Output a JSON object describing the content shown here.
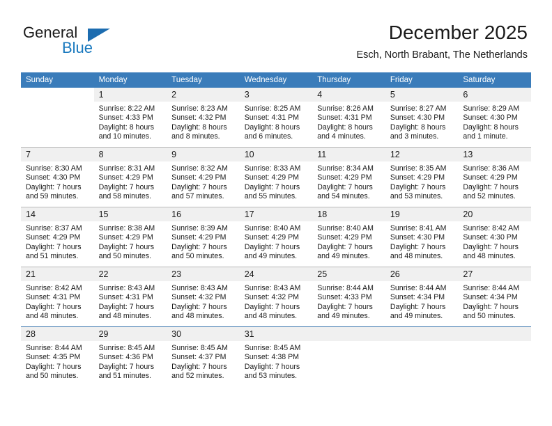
{
  "brand": {
    "word_one": "General",
    "word_two": "Blue",
    "logo_icon": "triangle-icon"
  },
  "header": {
    "title": "December 2025",
    "subtitle": "Esch, North Brabant, The Netherlands"
  },
  "colors": {
    "header_blue": "#3a7cba",
    "brand_blue": "#1878be",
    "band_gray": "#f0f0f0",
    "row_rule": "#b8b8b8",
    "last_row_rule": "#2f6ea8"
  },
  "weekday_headers": [
    "Sunday",
    "Monday",
    "Tuesday",
    "Wednesday",
    "Thursday",
    "Friday",
    "Saturday"
  ],
  "weeks": [
    [
      {
        "day": "",
        "lines": []
      },
      {
        "day": "1",
        "lines": [
          "Sunrise: 8:22 AM",
          "Sunset: 4:33 PM",
          "Daylight: 8 hours",
          "and 10 minutes."
        ]
      },
      {
        "day": "2",
        "lines": [
          "Sunrise: 8:23 AM",
          "Sunset: 4:32 PM",
          "Daylight: 8 hours",
          "and 8 minutes."
        ]
      },
      {
        "day": "3",
        "lines": [
          "Sunrise: 8:25 AM",
          "Sunset: 4:31 PM",
          "Daylight: 8 hours",
          "and 6 minutes."
        ]
      },
      {
        "day": "4",
        "lines": [
          "Sunrise: 8:26 AM",
          "Sunset: 4:31 PM",
          "Daylight: 8 hours",
          "and 4 minutes."
        ]
      },
      {
        "day": "5",
        "lines": [
          "Sunrise: 8:27 AM",
          "Sunset: 4:30 PM",
          "Daylight: 8 hours",
          "and 3 minutes."
        ]
      },
      {
        "day": "6",
        "lines": [
          "Sunrise: 8:29 AM",
          "Sunset: 4:30 PM",
          "Daylight: 8 hours",
          "and 1 minute."
        ]
      }
    ],
    [
      {
        "day": "7",
        "lines": [
          "Sunrise: 8:30 AM",
          "Sunset: 4:30 PM",
          "Daylight: 7 hours",
          "and 59 minutes."
        ]
      },
      {
        "day": "8",
        "lines": [
          "Sunrise: 8:31 AM",
          "Sunset: 4:29 PM",
          "Daylight: 7 hours",
          "and 58 minutes."
        ]
      },
      {
        "day": "9",
        "lines": [
          "Sunrise: 8:32 AM",
          "Sunset: 4:29 PM",
          "Daylight: 7 hours",
          "and 57 minutes."
        ]
      },
      {
        "day": "10",
        "lines": [
          "Sunrise: 8:33 AM",
          "Sunset: 4:29 PM",
          "Daylight: 7 hours",
          "and 55 minutes."
        ]
      },
      {
        "day": "11",
        "lines": [
          "Sunrise: 8:34 AM",
          "Sunset: 4:29 PM",
          "Daylight: 7 hours",
          "and 54 minutes."
        ]
      },
      {
        "day": "12",
        "lines": [
          "Sunrise: 8:35 AM",
          "Sunset: 4:29 PM",
          "Daylight: 7 hours",
          "and 53 minutes."
        ]
      },
      {
        "day": "13",
        "lines": [
          "Sunrise: 8:36 AM",
          "Sunset: 4:29 PM",
          "Daylight: 7 hours",
          "and 52 minutes."
        ]
      }
    ],
    [
      {
        "day": "14",
        "lines": [
          "Sunrise: 8:37 AM",
          "Sunset: 4:29 PM",
          "Daylight: 7 hours",
          "and 51 minutes."
        ]
      },
      {
        "day": "15",
        "lines": [
          "Sunrise: 8:38 AM",
          "Sunset: 4:29 PM",
          "Daylight: 7 hours",
          "and 50 minutes."
        ]
      },
      {
        "day": "16",
        "lines": [
          "Sunrise: 8:39 AM",
          "Sunset: 4:29 PM",
          "Daylight: 7 hours",
          "and 50 minutes."
        ]
      },
      {
        "day": "17",
        "lines": [
          "Sunrise: 8:40 AM",
          "Sunset: 4:29 PM",
          "Daylight: 7 hours",
          "and 49 minutes."
        ]
      },
      {
        "day": "18",
        "lines": [
          "Sunrise: 8:40 AM",
          "Sunset: 4:29 PM",
          "Daylight: 7 hours",
          "and 49 minutes."
        ]
      },
      {
        "day": "19",
        "lines": [
          "Sunrise: 8:41 AM",
          "Sunset: 4:30 PM",
          "Daylight: 7 hours",
          "and 48 minutes."
        ]
      },
      {
        "day": "20",
        "lines": [
          "Sunrise: 8:42 AM",
          "Sunset: 4:30 PM",
          "Daylight: 7 hours",
          "and 48 minutes."
        ]
      }
    ],
    [
      {
        "day": "21",
        "lines": [
          "Sunrise: 8:42 AM",
          "Sunset: 4:31 PM",
          "Daylight: 7 hours",
          "and 48 minutes."
        ]
      },
      {
        "day": "22",
        "lines": [
          "Sunrise: 8:43 AM",
          "Sunset: 4:31 PM",
          "Daylight: 7 hours",
          "and 48 minutes."
        ]
      },
      {
        "day": "23",
        "lines": [
          "Sunrise: 8:43 AM",
          "Sunset: 4:32 PM",
          "Daylight: 7 hours",
          "and 48 minutes."
        ]
      },
      {
        "day": "24",
        "lines": [
          "Sunrise: 8:43 AM",
          "Sunset: 4:32 PM",
          "Daylight: 7 hours",
          "and 48 minutes."
        ]
      },
      {
        "day": "25",
        "lines": [
          "Sunrise: 8:44 AM",
          "Sunset: 4:33 PM",
          "Daylight: 7 hours",
          "and 49 minutes."
        ]
      },
      {
        "day": "26",
        "lines": [
          "Sunrise: 8:44 AM",
          "Sunset: 4:34 PM",
          "Daylight: 7 hours",
          "and 49 minutes."
        ]
      },
      {
        "day": "27",
        "lines": [
          "Sunrise: 8:44 AM",
          "Sunset: 4:34 PM",
          "Daylight: 7 hours",
          "and 50 minutes."
        ]
      }
    ],
    [
      {
        "day": "28",
        "lines": [
          "Sunrise: 8:44 AM",
          "Sunset: 4:35 PM",
          "Daylight: 7 hours",
          "and 50 minutes."
        ]
      },
      {
        "day": "29",
        "lines": [
          "Sunrise: 8:45 AM",
          "Sunset: 4:36 PM",
          "Daylight: 7 hours",
          "and 51 minutes."
        ]
      },
      {
        "day": "30",
        "lines": [
          "Sunrise: 8:45 AM",
          "Sunset: 4:37 PM",
          "Daylight: 7 hours",
          "and 52 minutes."
        ]
      },
      {
        "day": "31",
        "lines": [
          "Sunrise: 8:45 AM",
          "Sunset: 4:38 PM",
          "Daylight: 7 hours",
          "and 53 minutes."
        ]
      },
      {
        "day": "",
        "lines": []
      },
      {
        "day": "",
        "lines": []
      },
      {
        "day": "",
        "lines": []
      }
    ]
  ]
}
